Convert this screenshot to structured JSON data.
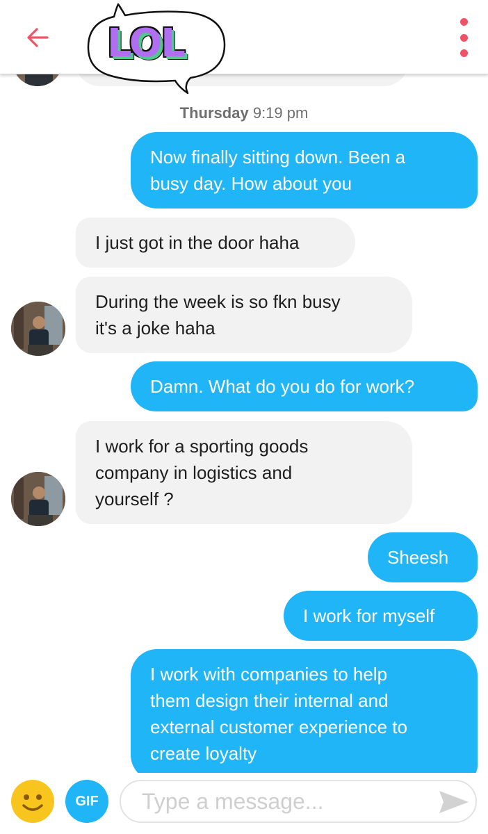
{
  "header": {
    "back_icon": "arrow-left-icon",
    "menu_icon": "more-vertical-icon",
    "sticker_text": "LOL",
    "accent_color": "#ef5466"
  },
  "chat": {
    "timestamp_day": "Thursday",
    "timestamp_time": "9:19 pm",
    "outgoing_color": "#1fb5f6",
    "incoming_color": "#f2f2f2",
    "messages": [
      {
        "direction": "out",
        "text": "Now finally sitting down. Been a\nbusy day. How about you"
      },
      {
        "direction": "in",
        "text": "I just got in the door haha"
      },
      {
        "direction": "in",
        "text": "During the week is so fkn busy\nit's a joke haha"
      },
      {
        "direction": "out",
        "text": "Damn. What do you do for work?"
      },
      {
        "direction": "in",
        "text": "I work for a sporting goods\ncompany in logistics and\nyourself ?"
      },
      {
        "direction": "out",
        "text": "Sheesh"
      },
      {
        "direction": "out",
        "text": "I work for myself"
      },
      {
        "direction": "out",
        "text": "I work with companies to help\nthem design their internal and\nexternal customer experience to\ncreate loyalty"
      }
    ]
  },
  "composer": {
    "emoji_icon": "smiley-face-icon",
    "gif_label": "GIF",
    "placeholder": "Type a message...",
    "value": "",
    "send_icon": "send-arrow-icon"
  }
}
